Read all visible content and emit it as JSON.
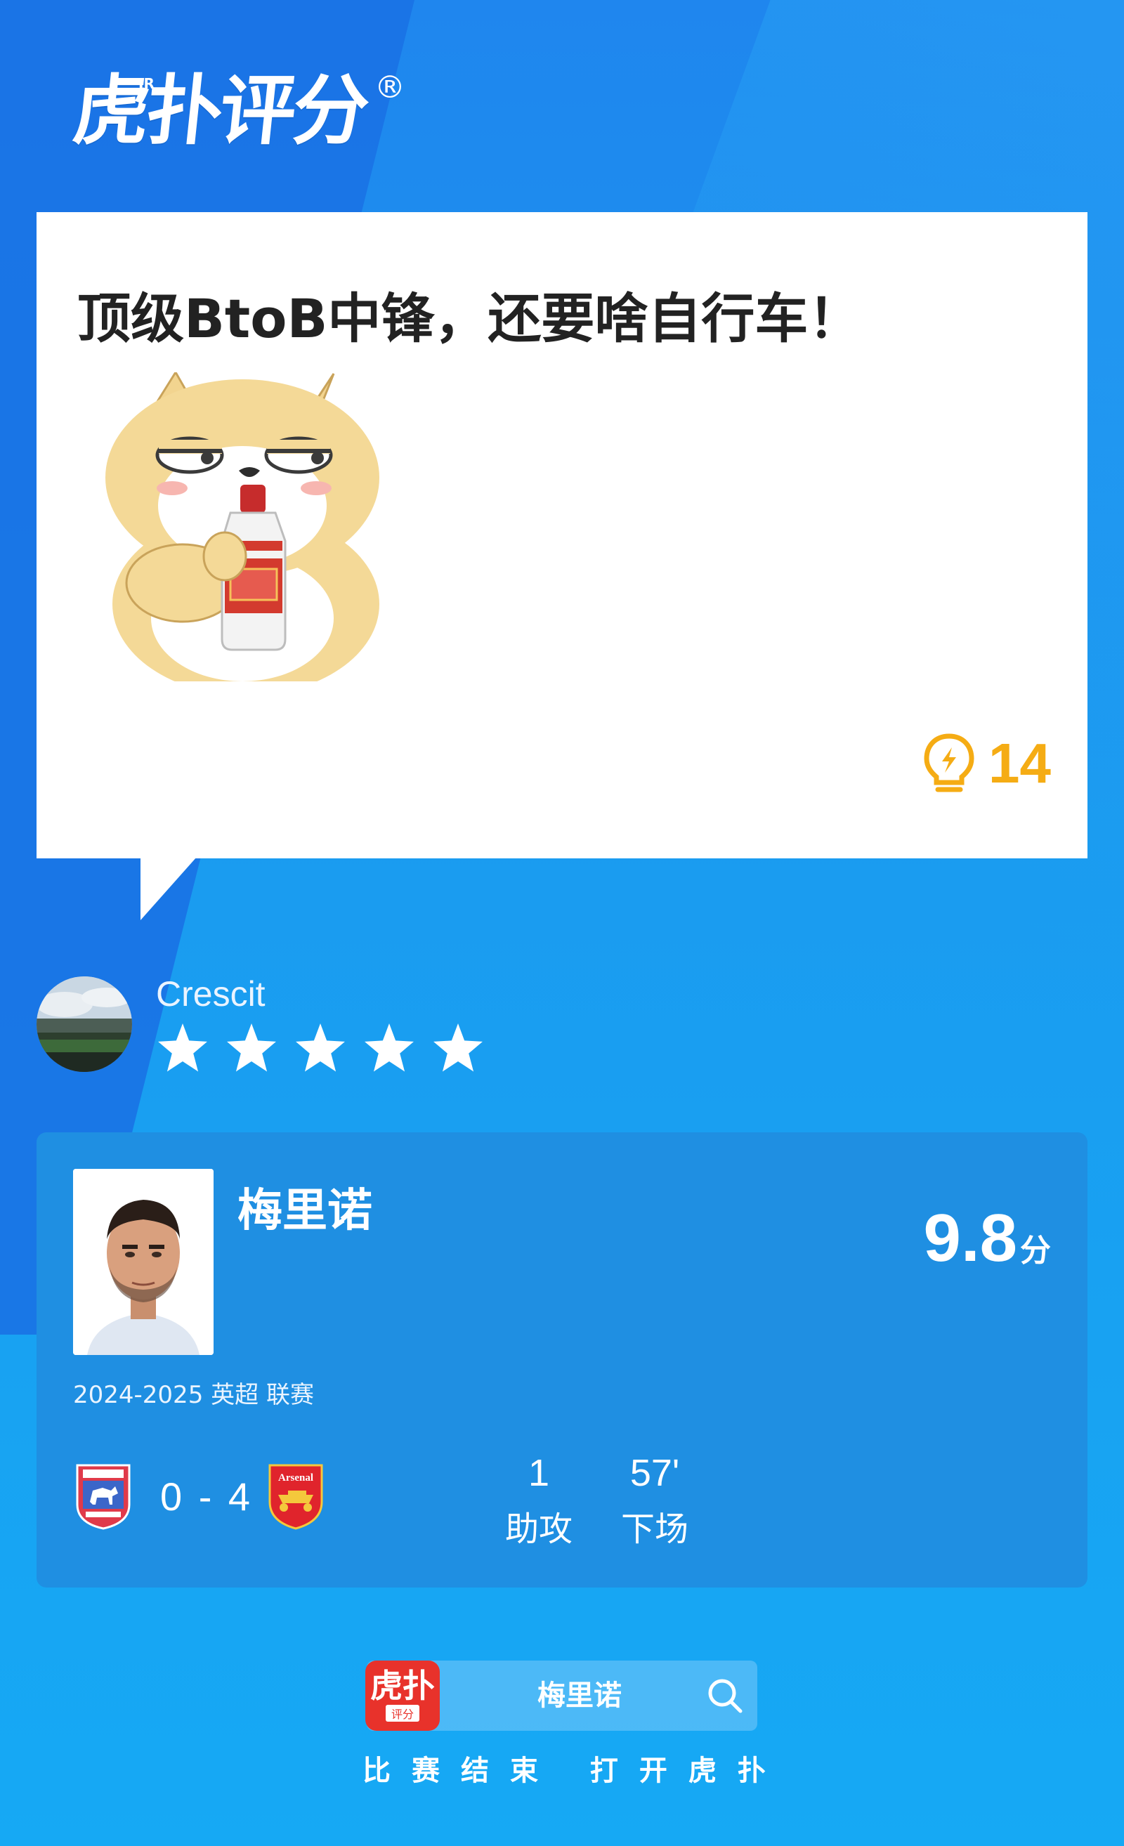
{
  "app": {
    "logo_text": "虎扑评分",
    "logo_jr": "JR",
    "logo_mark": "®"
  },
  "comment": {
    "text": "顶级BtoB中锋，还要啥自行车！",
    "sticker": "dog-drinking-baijiu-sticker",
    "likes": "14",
    "likes_icon": "lightbulb-icon",
    "likes_color": "#f5ac14"
  },
  "user": {
    "name": "Crescit",
    "rating_stars": 5,
    "rating_max": 5
  },
  "player": {
    "name": "梅里诺",
    "score": "9.8",
    "score_unit": "分",
    "season": "2024-2025 英超 联赛",
    "match_score": "0 - 4",
    "home_team": "ipswich-town-badge",
    "away_team_label": "Arsenal",
    "stats": [
      {
        "value": "1",
        "label": "助攻"
      },
      {
        "value": "57'",
        "label": "下场"
      }
    ]
  },
  "bottom": {
    "app_icon_text": "虎扑",
    "app_icon_sub": "评分",
    "search_text": "梅里诺",
    "footer": "比赛结束 打开虎扑"
  },
  "colors": {
    "background": "#1a9bf0",
    "card": "#1f8fe2",
    "accent_red": "#e8322b"
  }
}
